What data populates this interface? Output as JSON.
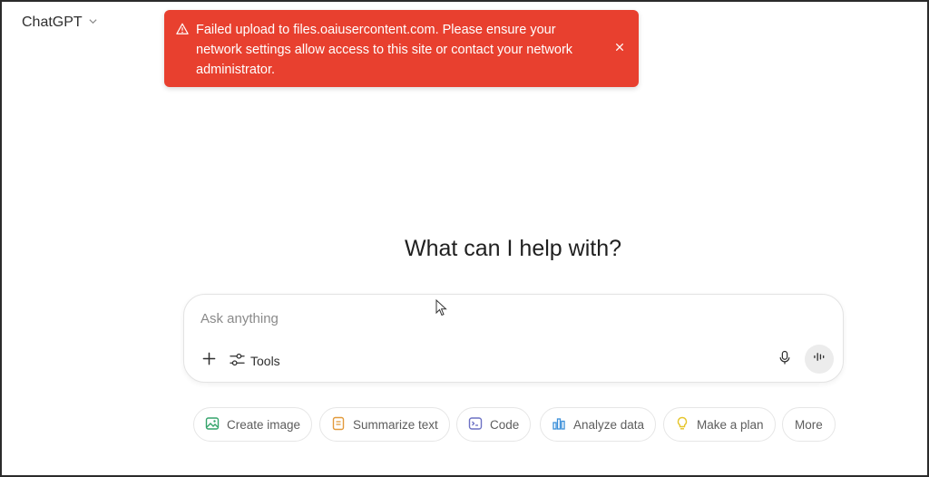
{
  "header": {
    "model_label": "ChatGPT",
    "model_icon": "chevron-down-icon"
  },
  "toast": {
    "type": "error",
    "icon": "warning-triangle-icon",
    "lines": [
      "Failed upload to files.oaiusercontent.com. Please ensure your",
      "network settings allow access to this site or contact your network",
      "administrator."
    ],
    "close_icon": "close-icon",
    "background_color": "#e8402f"
  },
  "main": {
    "heading": "What can I help with?"
  },
  "composer": {
    "placeholder": "Ask anything",
    "value": "",
    "add_icon": "plus-icon",
    "tools_label": "Tools",
    "tools_icon": "sliders-icon",
    "mic_icon": "microphone-icon",
    "voice_icon": "voice-mode-icon"
  },
  "suggestions": [
    {
      "label": "Create image",
      "icon": "image-icon",
      "color": "#35a46b"
    },
    {
      "label": "Summarize text",
      "icon": "document-icon",
      "color": "#e29a3b"
    },
    {
      "label": "Code",
      "icon": "terminal-icon",
      "color": "#6c71c4"
    },
    {
      "label": "Analyze data",
      "icon": "bar-chart-icon",
      "color": "#3a8fd9"
    },
    {
      "label": "Make a plan",
      "icon": "lightbulb-icon",
      "color": "#e6c52a"
    },
    {
      "label": "More",
      "icon": "",
      "color": ""
    }
  ]
}
